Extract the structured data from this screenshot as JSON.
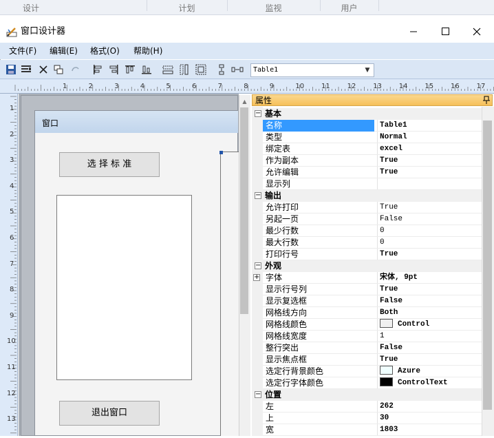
{
  "top_tabs": [
    "设计",
    "计划",
    "监视",
    "用户"
  ],
  "window": {
    "title": "窗口设计器",
    "controls": {
      "minimize": "—",
      "maximize": "☐",
      "close": "✕"
    }
  },
  "menu": [
    "文件(F)",
    "编辑(E)",
    "格式(O)",
    "帮助(H)"
  ],
  "toolbar": {
    "object_select_value": "Table1",
    "icons": [
      "save-icon",
      "properties-icon",
      "delete-icon",
      "copy-icon",
      "undo-icon",
      "align-left-icon",
      "align-right-icon",
      "align-top-icon",
      "align-bottom-icon",
      "same-width-icon",
      "same-height-icon",
      "same-size-icon",
      "vertical-spacing-icon",
      "horizontal-spacing-icon"
    ]
  },
  "ruler": {
    "h": [
      "1",
      "2",
      "3",
      "4",
      "5",
      "6",
      "7",
      "8",
      "9",
      "10",
      "11",
      "12",
      "13",
      "14",
      "15",
      "16",
      "17"
    ],
    "v": [
      "1",
      "2",
      "3",
      "4",
      "5",
      "6",
      "7",
      "8",
      "9",
      "10",
      "11",
      "12",
      "13"
    ]
  },
  "form": {
    "title": "窗口",
    "select_button": "选 择 标 准",
    "exit_button": "退出窗口"
  },
  "properties": {
    "panel_title": "属性",
    "pin": "ᵖ",
    "categories": [
      {
        "label": "基本",
        "toggle": "−",
        "rows": [
          {
            "name": "名称",
            "value": "Table1",
            "selected": true
          },
          {
            "name": "类型",
            "value": "Normal"
          },
          {
            "name": "绑定表",
            "value": "excel"
          },
          {
            "name": "作为副本",
            "value": "True"
          },
          {
            "name": "允许编辑",
            "value": "True"
          },
          {
            "name": "显示列",
            "value": ""
          }
        ]
      },
      {
        "label": "输出",
        "toggle": "−",
        "rows": [
          {
            "name": "允许打印",
            "value": "True",
            "plain": true
          },
          {
            "name": "另起一页",
            "value": "False",
            "plain": true
          },
          {
            "name": "最少行数",
            "value": "0",
            "plain": true
          },
          {
            "name": "最大行数",
            "value": "0",
            "plain": true
          },
          {
            "name": "打印行号",
            "value": "True"
          }
        ]
      },
      {
        "label": "外观",
        "toggle": "−",
        "rows": [
          {
            "name": "字体",
            "value": "宋体, 9pt",
            "expandable": true
          },
          {
            "name": "显示行号列",
            "value": "True"
          },
          {
            "name": "显示复选框",
            "value": "False"
          },
          {
            "name": "网格线方向",
            "value": "Both"
          },
          {
            "name": "网格线颜色",
            "value": "Control",
            "swatch": "#f0f0f0"
          },
          {
            "name": "网格线宽度",
            "value": "1",
            "plain": true
          },
          {
            "name": "整行突出",
            "value": "False"
          },
          {
            "name": "显示焦点框",
            "value": "True"
          },
          {
            "name": "选定行背景颜色",
            "value": "Azure",
            "swatch": "#f0ffff"
          },
          {
            "name": "选定行字体颜色",
            "value": "ControlText",
            "swatch": "#000000"
          }
        ]
      },
      {
        "label": "位置",
        "toggle": "−",
        "rows": [
          {
            "name": "左",
            "value": "262"
          },
          {
            "name": "上",
            "value": "30"
          },
          {
            "name": "宽",
            "value": "1803"
          }
        ]
      }
    ]
  }
}
